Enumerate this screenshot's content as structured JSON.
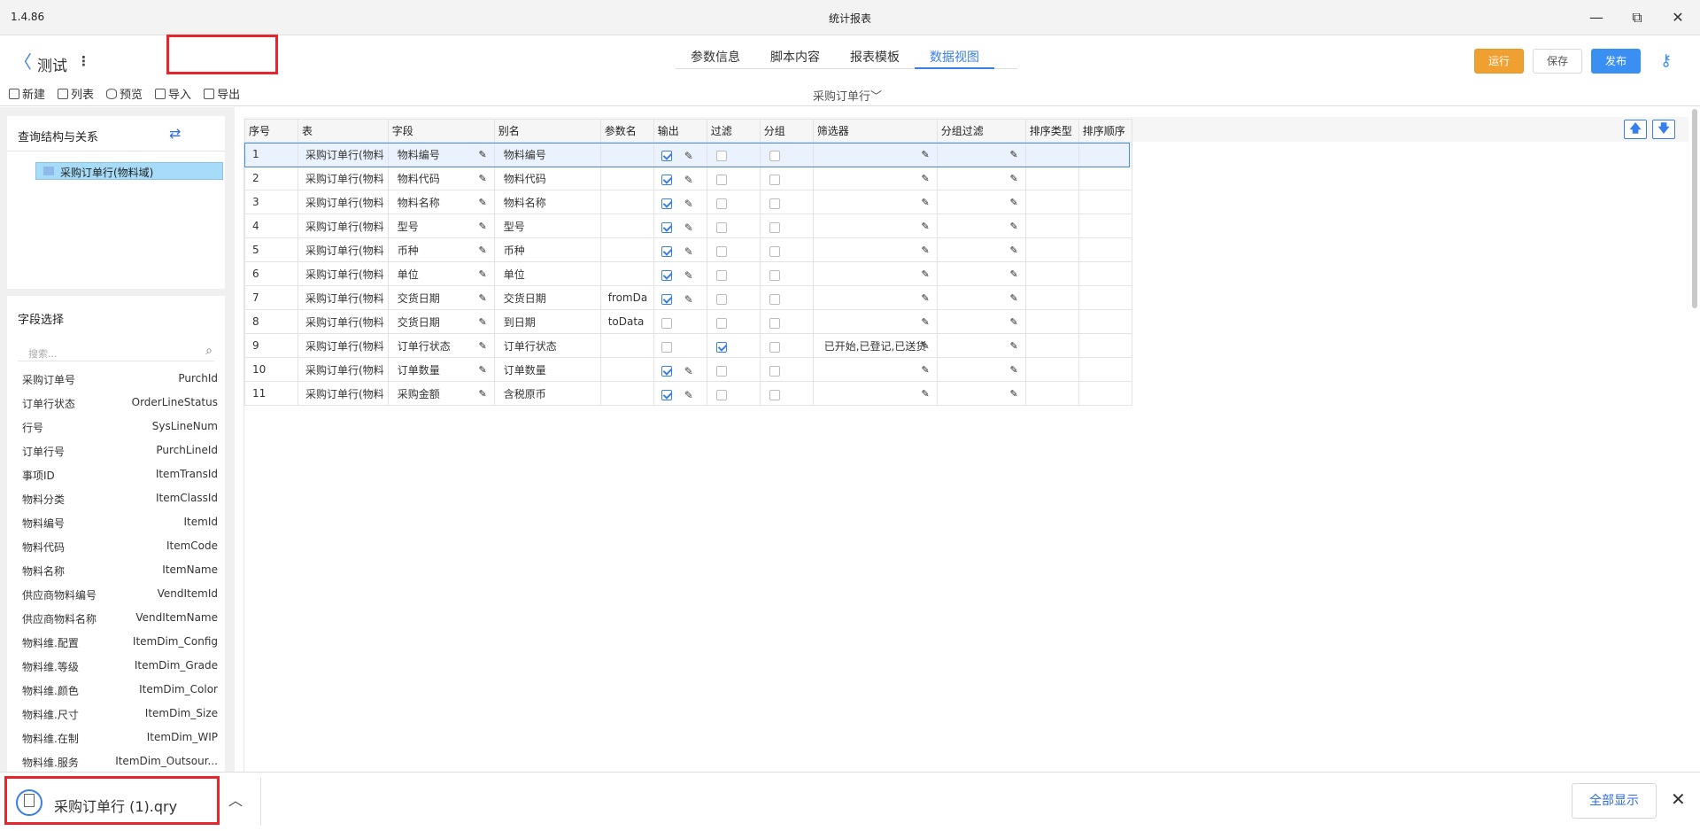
{
  "window": {
    "version": "1.4.86",
    "title": "统计报表",
    "minimize": "—",
    "restore": "⧉",
    "close": "✕"
  },
  "header": {
    "back": "〈",
    "title": "测试",
    "more": "⋮",
    "tabs": [
      "参数信息",
      "脚本内容",
      "报表模板",
      "数据视图"
    ],
    "active_tab": "数据视图",
    "run_label": "运行",
    "save_label": "保存",
    "publish_label": "发布",
    "key_icon": "⚷"
  },
  "toolbar": {
    "new_label": "新建",
    "list_label": "列表",
    "preview_label": "预览",
    "import_label": "导入",
    "export_label": "导出",
    "sub_select": "采购订单行﹀"
  },
  "query_panel": {
    "title": "查询结构与关系",
    "swap_icon": "⇄",
    "tree_node": "采购订单行(物料域)"
  },
  "field_panel": {
    "title": "字段选择",
    "search_placeholder": "搜索...",
    "search_icon": "⌕",
    "fields": [
      {
        "cn": "采购订单号",
        "en": "PurchId"
      },
      {
        "cn": "订单行状态",
        "en": "OrderLineStatus"
      },
      {
        "cn": "行号",
        "en": "SysLineNum"
      },
      {
        "cn": "订单行号",
        "en": "PurchLineId"
      },
      {
        "cn": "事项ID",
        "en": "ItemTransId"
      },
      {
        "cn": "物料分类",
        "en": "ItemClassId"
      },
      {
        "cn": "物料编号",
        "en": "ItemId"
      },
      {
        "cn": "物料代码",
        "en": "ItemCode"
      },
      {
        "cn": "物料名称",
        "en": "ItemName"
      },
      {
        "cn": "供应商物料编号",
        "en": "VendItemId"
      },
      {
        "cn": "供应商物料名称",
        "en": "VendItemName"
      },
      {
        "cn": "物料维.配置",
        "en": "ItemDim_Config"
      },
      {
        "cn": "物料维.等级",
        "en": "ItemDim_Grade"
      },
      {
        "cn": "物料维.颜色",
        "en": "ItemDim_Color"
      },
      {
        "cn": "物料维.尺寸",
        "en": "ItemDim_Size"
      },
      {
        "cn": "物料维.在制",
        "en": "ItemDim_WIP"
      },
      {
        "cn": "物料维.服务",
        "en": "ItemDim_Outsour..."
      }
    ]
  },
  "grid": {
    "columns": [
      "序号",
      "表",
      "字段",
      "别名",
      "参数名",
      "输出",
      "过滤",
      "分组",
      "筛选器",
      "分组过滤",
      "排序类型",
      "排序顺序"
    ],
    "pen_icon": "✎",
    "edit_icon": "✎",
    "rows": [
      {
        "no": "1",
        "table": "采购订单行(物料",
        "field": "物料编号",
        "alias": "物料编号",
        "param": "",
        "output": true,
        "output_edit": true,
        "filter": false,
        "group": false,
        "selector": ""
      },
      {
        "no": "2",
        "table": "采购订单行(物料",
        "field": "物料代码",
        "alias": "物料代码",
        "param": "",
        "output": true,
        "output_edit": true,
        "filter": false,
        "group": false,
        "selector": ""
      },
      {
        "no": "3",
        "table": "采购订单行(物料",
        "field": "物料名称",
        "alias": "物料名称",
        "param": "",
        "output": true,
        "output_edit": true,
        "filter": false,
        "group": false,
        "selector": ""
      },
      {
        "no": "4",
        "table": "采购订单行(物料",
        "field": "型号",
        "alias": "型号",
        "param": "",
        "output": true,
        "output_edit": true,
        "filter": false,
        "group": false,
        "selector": ""
      },
      {
        "no": "5",
        "table": "采购订单行(物料",
        "field": "币种",
        "alias": "币种",
        "param": "",
        "output": true,
        "output_edit": true,
        "filter": false,
        "group": false,
        "selector": ""
      },
      {
        "no": "6",
        "table": "采购订单行(物料",
        "field": "单位",
        "alias": "单位",
        "param": "",
        "output": true,
        "output_edit": true,
        "filter": false,
        "group": false,
        "selector": ""
      },
      {
        "no": "7",
        "table": "采购订单行(物料",
        "field": "交货日期",
        "alias": "交货日期",
        "param": "fromDa",
        "output": true,
        "output_edit": true,
        "filter": false,
        "group": false,
        "selector": ""
      },
      {
        "no": "8",
        "table": "采购订单行(物料",
        "field": "交货日期",
        "alias": "到日期",
        "param": "toData",
        "output": false,
        "output_edit": false,
        "filter": false,
        "group": false,
        "selector": ""
      },
      {
        "no": "9",
        "table": "采购订单行(物料",
        "field": "订单行状态",
        "alias": "订单行状态",
        "param": "",
        "output": false,
        "output_edit": false,
        "filter": true,
        "group": false,
        "selector": "已开始,已登记,已送货"
      },
      {
        "no": "10",
        "table": "采购订单行(物料",
        "field": "订单数量",
        "alias": "订单数量",
        "param": "",
        "output": true,
        "output_edit": true,
        "filter": false,
        "group": false,
        "selector": ""
      },
      {
        "no": "11",
        "table": "采购订单行(物料",
        "field": "采购金额",
        "alias": "含税原币",
        "param": "",
        "output": true,
        "output_edit": true,
        "filter": false,
        "group": false,
        "selector": ""
      }
    ],
    "up_icon": "🡅",
    "down_icon": "🡇"
  },
  "download_bar": {
    "file_name": "采购订单行 (1).qry",
    "chevron": "︿",
    "show_all": "全部显示",
    "close": "✕"
  }
}
